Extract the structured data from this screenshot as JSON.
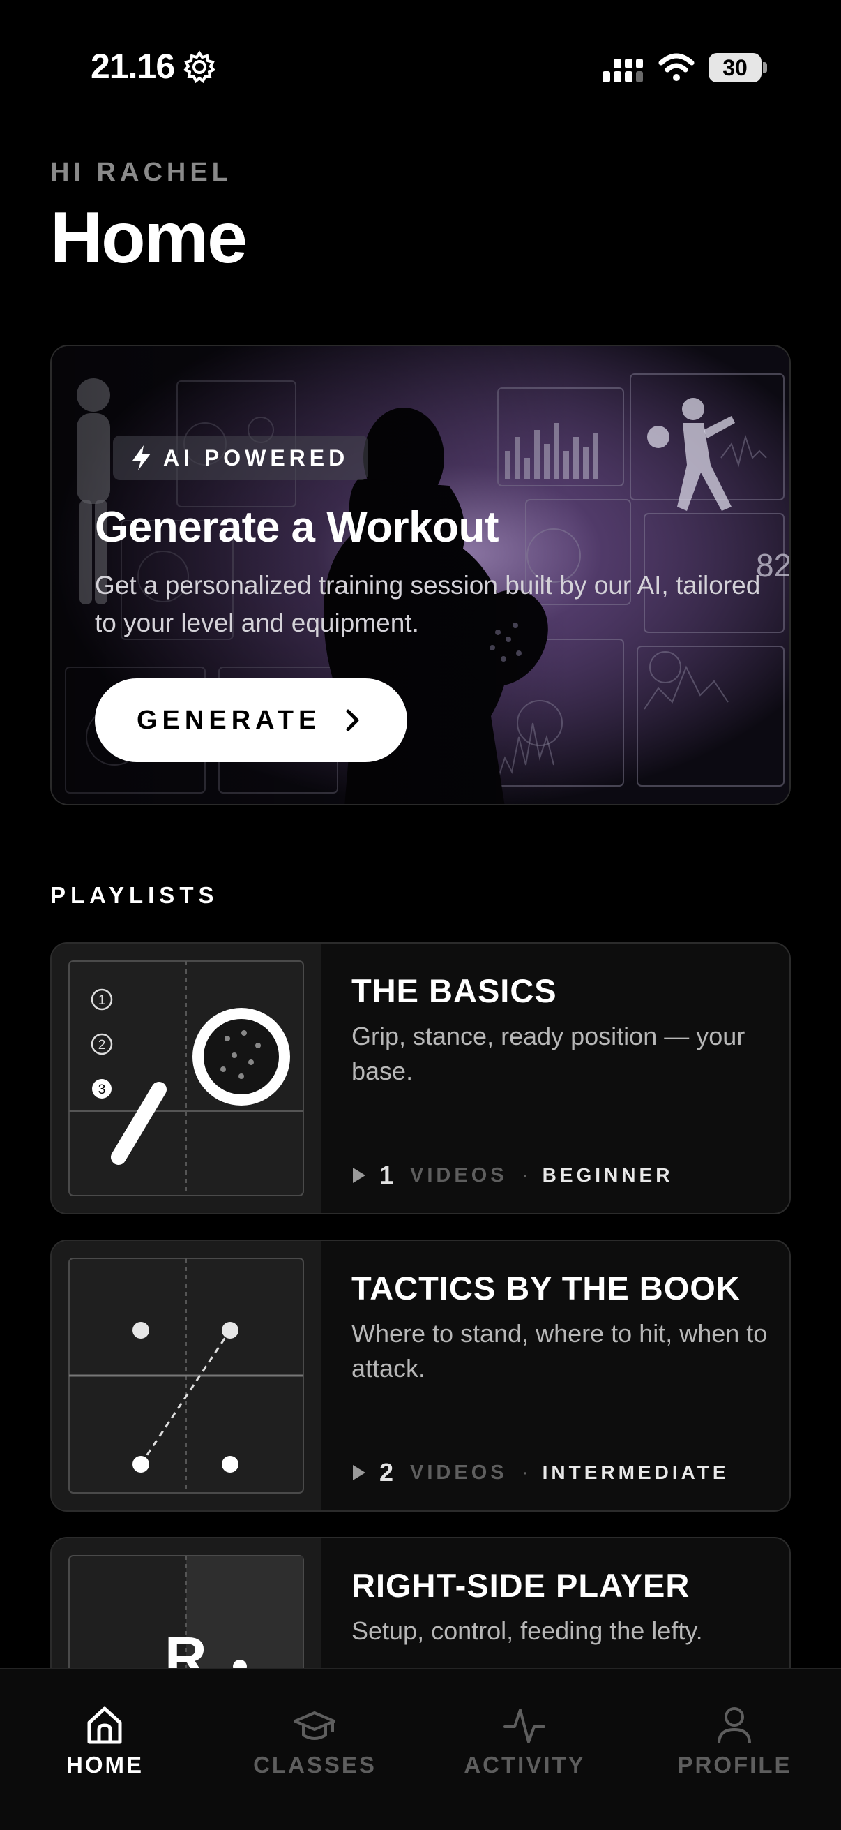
{
  "status_bar": {
    "time": "21.16",
    "battery": "30"
  },
  "header": {
    "greeting": "HI RACHEL",
    "title": "Home"
  },
  "hero": {
    "badge": "AI POWERED",
    "title": "Generate a Workout",
    "description": "Get a personalized training session built by our AI, tailored to your level and equipment.",
    "button_label": "GENERATE",
    "background_text": "82"
  },
  "playlists": {
    "section_label": "PLAYLISTS",
    "items": [
      {
        "title": "THE BASICS",
        "description": "Grip, stance, ready position — your base.",
        "count": "1",
        "videos_label": "VIDEOS",
        "separator": "·",
        "level": "BEGINNER",
        "thumb_numbers": [
          "1",
          "2",
          "3"
        ]
      },
      {
        "title": "TACTICS BY THE BOOK",
        "description": "Where to stand, where to hit, when to attack.",
        "count": "2",
        "videos_label": "VIDEOS",
        "separator": "·",
        "level": "INTERMEDIATE"
      },
      {
        "title": "RIGHT-SIDE PLAYER",
        "description": "Setup, control, feeding the lefty.",
        "thumb_letter": "R"
      }
    ]
  },
  "bottom_nav": {
    "items": [
      {
        "label": "HOME",
        "icon": "home-icon",
        "active": true
      },
      {
        "label": "CLASSES",
        "icon": "graduation-cap-icon",
        "active": false
      },
      {
        "label": "ACTIVITY",
        "icon": "activity-pulse-icon",
        "active": false
      },
      {
        "label": "PROFILE",
        "icon": "user-icon",
        "active": false
      }
    ]
  },
  "colors": {
    "background": "#000000",
    "muted": "#5e5e5e",
    "card": "#0d0d0d",
    "accent": "#ffffff",
    "hero_glow": "#8a6aa8"
  }
}
